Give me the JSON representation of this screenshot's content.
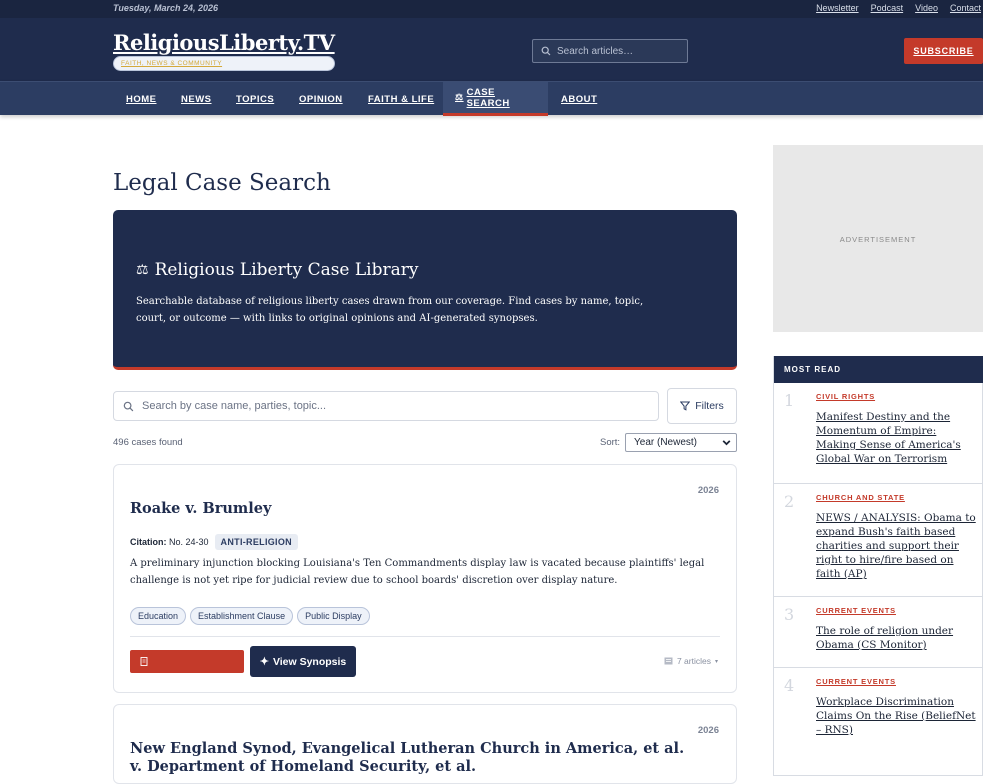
{
  "topbar": {
    "date": "Tuesday, March 24, 2026",
    "links": [
      "Newsletter",
      "Podcast",
      "Video",
      "Contact"
    ]
  },
  "masthead": {
    "logo": "ReligiousLiberty.TV",
    "tagline": "FAITH, NEWS & COMMUNITY",
    "search_placeholder": "Search articles…",
    "subscribe": "SUBSCRIBE"
  },
  "nav": {
    "items": [
      "HOME",
      "NEWS",
      "TOPICS",
      "OPINION",
      "FAITH & LIFE",
      "CASE SEARCH",
      "ABOUT"
    ],
    "active": "CASE SEARCH"
  },
  "page": {
    "title": "Legal Case Search"
  },
  "hero": {
    "title": "Religious Liberty Case Library",
    "description": "Searchable database of religious liberty cases drawn from our coverage. Find cases by name, topic, court, or outcome — with links to original opinions and AI-generated synopses."
  },
  "search": {
    "placeholder": "Search by case name, parties, topic...",
    "filters_label": "Filters",
    "count": "496 cases found",
    "sort_label": "Sort:",
    "sort_value": "Year (Newest)"
  },
  "cases": [
    {
      "year": "2026",
      "title": "Roake v. Brumley",
      "citation_label": "Citation:",
      "citation": "No. 24-30",
      "badge": "ANTI-RELIGION",
      "synopsis": "A preliminary injunction blocking Louisiana's Ten Commandments display law is vacated because plaintiffs' legal challenge is not yet ripe for judicial review due to school boards' discretion over display nature.",
      "tags": [
        "Education",
        "Establishment Clause",
        "Public Display"
      ],
      "synopsis_button": "View Synopsis",
      "articles": "7 articles"
    },
    {
      "year": "2026",
      "title": "New England Synod, Evangelical Lutheran Church in America, et al. v. Department of Homeland Security, et al."
    }
  ],
  "sidebar": {
    "ad_label": "ADVERTISEMENT",
    "most_read_title": "MOST READ",
    "most_read": [
      {
        "num": "1",
        "category": "CIVIL RIGHTS",
        "headline": "Manifest Destiny and the Momentum of Empire: Making Sense of America's Global War on Terrorism"
      },
      {
        "num": "2",
        "category": "CHURCH AND STATE",
        "headline": "NEWS / ANALYSIS: Obama to expand Bush's faith based charities and support their right to hire/fire based on faith (AP)"
      },
      {
        "num": "3",
        "category": "CURRENT EVENTS",
        "headline": "The role of religion under Obama (CS Monitor)"
      },
      {
        "num": "4",
        "category": "CURRENT EVENTS",
        "headline": "Workplace Discrimination Claims On the Rise (BeliefNet – RNS)"
      }
    ]
  },
  "colors": {
    "navy": "#1f2c4d",
    "accent_red": "#c43a2a",
    "gold": "#d4a93a"
  }
}
